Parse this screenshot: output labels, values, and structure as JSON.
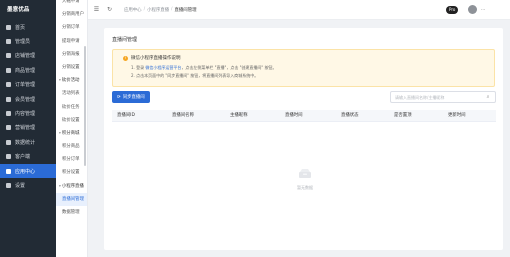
{
  "brand": "墨意优品",
  "nav": [
    {
      "label": "首页",
      "icon": "home-icon"
    },
    {
      "label": "管理员",
      "icon": "user-icon"
    },
    {
      "label": "店铺管理",
      "icon": "shop-icon"
    },
    {
      "label": "商品管理",
      "icon": "goods-icon"
    },
    {
      "label": "订单管理",
      "icon": "order-icon"
    },
    {
      "label": "会员管理",
      "icon": "member-icon"
    },
    {
      "label": "内容管理",
      "icon": "content-icon"
    },
    {
      "label": "营销管理",
      "icon": "marketing-icon"
    },
    {
      "label": "数据统计",
      "icon": "stats-icon"
    },
    {
      "label": "客户端",
      "icon": "client-icon"
    },
    {
      "label": "应用中心",
      "icon": "apps-icon",
      "active": true
    },
    {
      "label": "设置",
      "icon": "gear-icon"
    }
  ],
  "submenu": [
    {
      "label": "大転申请"
    },
    {
      "label": "分销商用户"
    },
    {
      "label": "分销订单"
    },
    {
      "label": "提现申请"
    },
    {
      "label": "分销海报"
    },
    {
      "label": "分销设置"
    },
    {
      "label": "砍价活动",
      "group": true
    },
    {
      "label": "活动列表"
    },
    {
      "label": "砍价任务"
    },
    {
      "label": "砍价设置"
    },
    {
      "label": "积分商城",
      "group": true
    },
    {
      "label": "积分商品"
    },
    {
      "label": "积分订单"
    },
    {
      "label": "积分设置"
    },
    {
      "label": "小程序直播",
      "group": true
    },
    {
      "label": "直播间管理",
      "active": true
    },
    {
      "label": "数据管理"
    }
  ],
  "header": {
    "breadcrumb": [
      "应用中心",
      "小程序直播",
      "直播间管理"
    ],
    "pro_badge": "Pro",
    "username": "..."
  },
  "card": {
    "title": "直播间管理",
    "notice": {
      "title": "微信小程序直播操作说明",
      "line1_a": "1. 登录",
      "line1_link": "微信小程序运营平台",
      "line1_b": "，点击左侧菜单栏 \"直播\"，点击 \"创建直播间\" 按钮。",
      "line2": "2. 点击本页面中的 \"同步直播间\" 按钮，将直播间列表导入商城系统中。"
    },
    "sync_button": "同步直播间",
    "search_placeholder": "请输入直播间名称/主播昵称"
  },
  "table": {
    "columns": [
      "直播间ID",
      "直播间名称",
      "主播昵称",
      "直播时间",
      "直播状态",
      "是否置顶",
      "更新时间"
    ],
    "empty_text": "暂无数据"
  }
}
